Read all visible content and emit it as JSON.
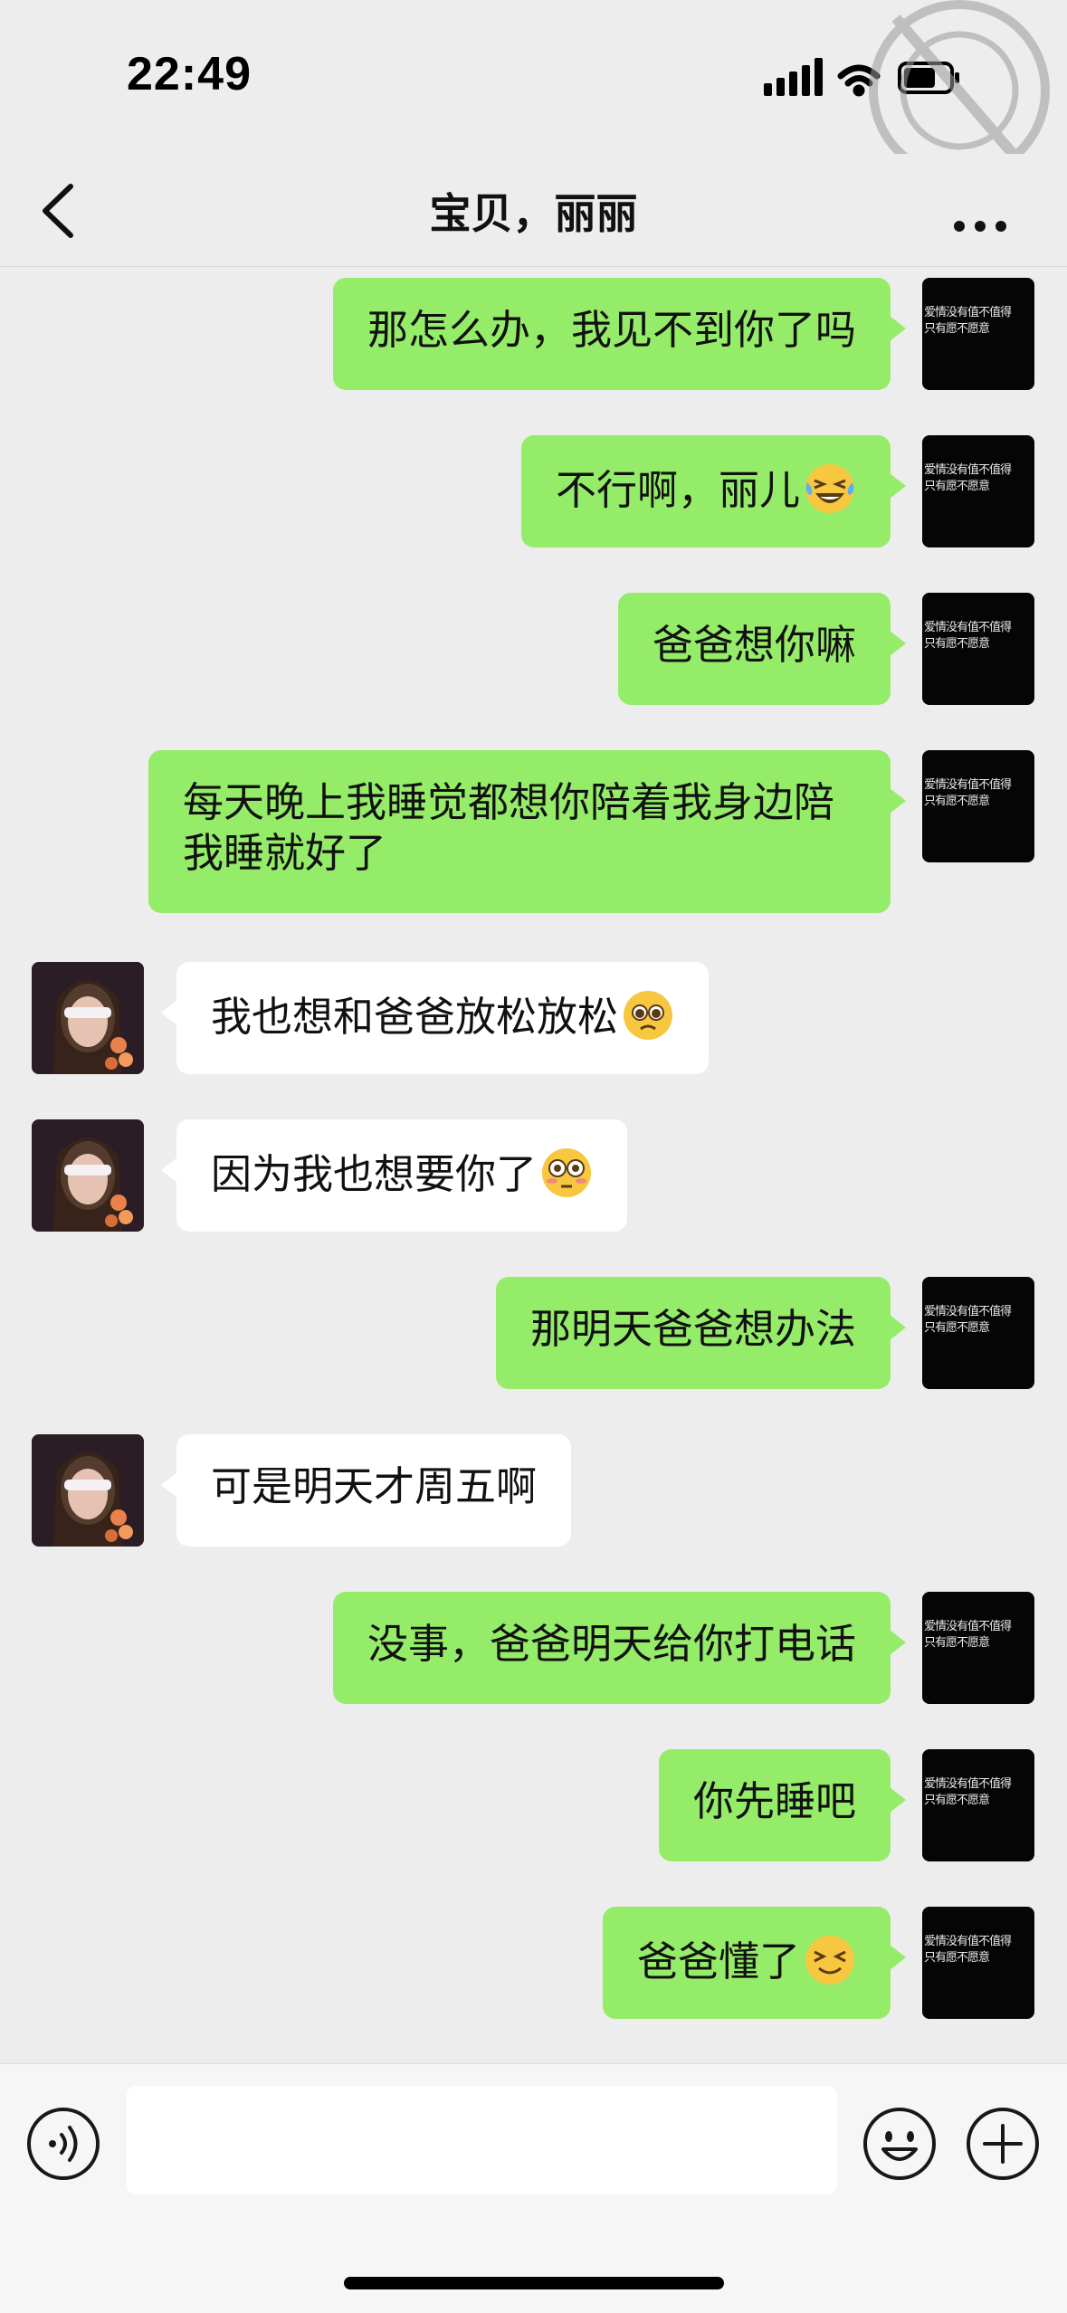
{
  "status_bar": {
    "time": "22:49"
  },
  "nav": {
    "title": "宝贝，丽丽"
  },
  "me_avatar_caption": "爱情没有值不值得\n只有愿不愿意",
  "messages": [
    {
      "side": "out",
      "text": "那怎么办，我见不到你了吗"
    },
    {
      "side": "out",
      "text": "不行啊，丽儿",
      "emoji": "laughing-tears-emoji"
    },
    {
      "side": "out",
      "text": "爸爸想你嘛"
    },
    {
      "side": "out",
      "text": "每天晚上我睡觉都想你陪着我身边陪我睡就好了"
    },
    {
      "side": "in",
      "text": "我也想和爸爸放松放松",
      "emoji": "pleading-emoji"
    },
    {
      "side": "in",
      "text": "因为我也想要你了",
      "emoji": "flushed-emoji"
    },
    {
      "side": "out",
      "text": "那明天爸爸想办法"
    },
    {
      "side": "in",
      "text": "可是明天才周五啊"
    },
    {
      "side": "out",
      "text": "没事，爸爸明天给你打电话"
    },
    {
      "side": "out",
      "text": "你先睡吧"
    },
    {
      "side": "out",
      "text": "爸爸懂了",
      "emoji": "grinning-squint-emoji"
    }
  ],
  "input": {
    "value": ""
  },
  "colors": {
    "background": "#ededed",
    "outgoing_bubble": "#95ec69",
    "incoming_bubble": "#ffffff"
  },
  "icons": {
    "back": "chevron-left-icon",
    "more": "more-dots-icon",
    "voice": "voice-icon",
    "emoji": "smiley-icon",
    "plus": "plus-icon"
  }
}
